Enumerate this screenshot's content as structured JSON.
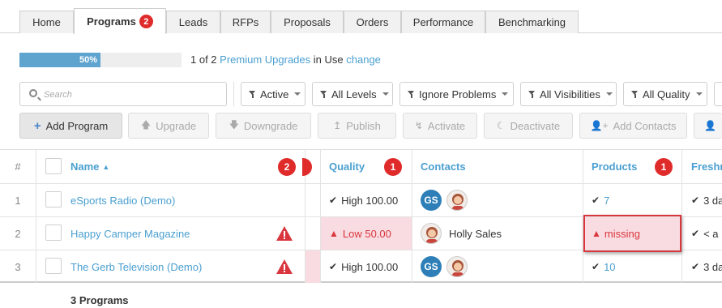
{
  "tabs": [
    {
      "label": "Home"
    },
    {
      "label": "Programs",
      "badge": "2",
      "active": true
    },
    {
      "label": "Leads"
    },
    {
      "label": "RFPs"
    },
    {
      "label": "Proposals"
    },
    {
      "label": "Orders"
    },
    {
      "label": "Performance"
    },
    {
      "label": "Benchmarking"
    }
  ],
  "usage": {
    "progress_label": "50%",
    "progress_fraction": 0.5,
    "count_text": "1 of 2",
    "upgrades_link": "Premium Upgrades",
    "in_use_text": "in Use",
    "change_link": "change"
  },
  "search": {
    "placeholder": "Search",
    "icon": "search-icon"
  },
  "filters": [
    {
      "label": "Active"
    },
    {
      "label": "All Levels"
    },
    {
      "label": "Ignore Problems"
    },
    {
      "label": "All Visibilities"
    },
    {
      "label": "All Quality"
    }
  ],
  "actions": [
    {
      "label": "Add Program",
      "icon": "plus-icon",
      "enabled": true
    },
    {
      "label": "Upgrade",
      "icon": "arrow-up-icon",
      "enabled": false
    },
    {
      "label": "Downgrade",
      "icon": "arrow-down-icon",
      "enabled": false
    },
    {
      "label": "Publish",
      "icon": "upload-icon",
      "enabled": false
    },
    {
      "label": "Activate",
      "icon": "bolt-icon",
      "enabled": false
    },
    {
      "label": "Deactivate",
      "icon": "moon-icon",
      "enabled": false
    },
    {
      "label": "Add Contacts",
      "icon": "user-plus-icon",
      "enabled": false
    }
  ],
  "table": {
    "headers": {
      "num": "#",
      "name": "Name",
      "name_badge": "2",
      "quality": "Quality",
      "quality_badge": "1",
      "contacts": "Contacts",
      "products": "Products",
      "products_badge": "1",
      "freshness": "Freshn"
    },
    "rows": [
      {
        "num": "1",
        "name": "eSports Radio (Demo)",
        "warn": false,
        "quality": "High 100.00",
        "quality_low": false,
        "contact_initials": "GS",
        "contact_name": "",
        "products": "7",
        "products_missing": false,
        "fresh": "3 da"
      },
      {
        "num": "2",
        "name": "Happy Camper Magazine",
        "warn": true,
        "quality": "Low 50.00",
        "quality_low": true,
        "contact_initials": "",
        "contact_name": "Holly Sales",
        "products": "missing",
        "products_missing": true,
        "fresh": "< a"
      },
      {
        "num": "3",
        "name": "The Gerb Television (Demo)",
        "warn": true,
        "quality": "High 100.00",
        "quality_low": false,
        "contact_initials": "GS",
        "contact_name": "",
        "products": "10",
        "products_missing": false,
        "fresh": "3 da"
      }
    ]
  },
  "footer": "3 Programs",
  "colors": {
    "accent": "#4a9fd0",
    "danger": "#e02b2b",
    "low_bg": "#f9dce1",
    "progress": "#5fa3cf"
  }
}
